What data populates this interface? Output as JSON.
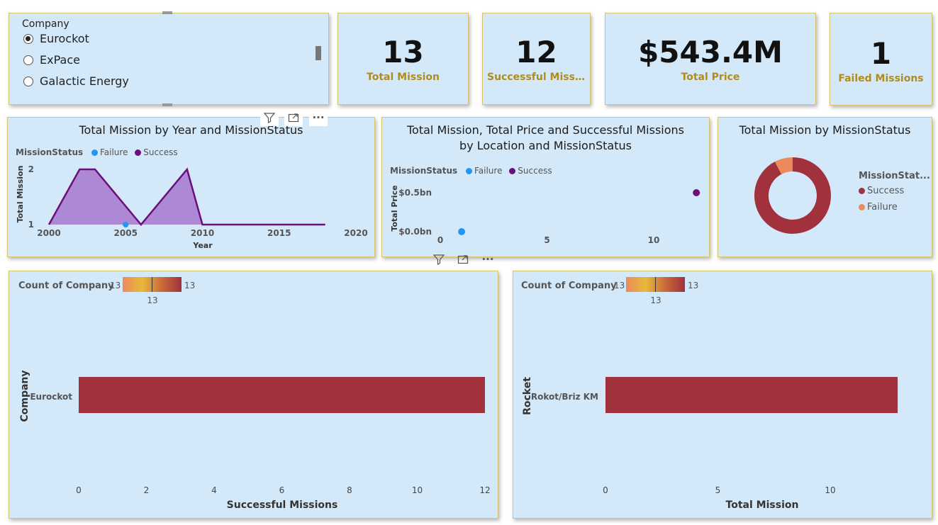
{
  "slicer": {
    "title": "Company",
    "options": [
      {
        "label": "Eurockot",
        "selected": true
      },
      {
        "label": "ExPace",
        "selected": false
      },
      {
        "label": "Galactic Energy",
        "selected": false
      }
    ]
  },
  "kpis": [
    {
      "value": "13",
      "label": "Total Mission"
    },
    {
      "value": "12",
      "label": "Successful Missions"
    },
    {
      "value": "$543.4M",
      "label": "Total Price"
    },
    {
      "value": "1",
      "label": "Failed Missions"
    }
  ],
  "visual_header_icons": [
    "filter-icon",
    "focus-mode-icon",
    "more-options-icon"
  ],
  "colors": {
    "failure": "#2196f3",
    "success": "#6b0f7a",
    "donut_success": "#a0313d",
    "donut_failure": "#ec8a5b",
    "bar": "#a0313d",
    "kpi_label": "#b08d1a",
    "tile_bg": "#d3e9fa",
    "tile_border": "#d6c56a"
  },
  "year_chart": {
    "title": "Total Mission by Year and MissionStatus",
    "legend_title": "MissionStatus",
    "legend": [
      "Failure",
      "Success"
    ],
    "ylabel": "Total Mission",
    "xlabel": "Year",
    "x_ticks": [
      "2000",
      "2005",
      "2010",
      "2015",
      "2020"
    ],
    "y_ticks": [
      "1",
      "2"
    ]
  },
  "location_chart": {
    "title": "Total Mission, Total Price and Successful Missions by Location and MissionStatus",
    "legend_title": "MissionStatus",
    "legend": [
      "Failure",
      "Success"
    ],
    "ylabel": "Total Price",
    "x_ticks": [
      "0",
      "5",
      "10"
    ],
    "y_ticks": [
      "$0.0bn",
      "$0.5bn"
    ]
  },
  "donut_chart": {
    "title": "Total Mission by MissionStatus",
    "legend_title": "MissionStat...",
    "legend": [
      "Success",
      "Failure"
    ]
  },
  "company_chart": {
    "gradient_title": "Count of Company",
    "gradient_min": "13",
    "gradient_max": "13",
    "gradient_mid": "13",
    "ylabel": "Company",
    "xlabel": "Successful Missions",
    "category": "Eurockot",
    "x_ticks": [
      "0",
      "2",
      "4",
      "6",
      "8",
      "10",
      "12"
    ]
  },
  "rocket_chart": {
    "gradient_title": "Count of Company",
    "gradient_min": "13",
    "gradient_max": "13",
    "gradient_mid": "13",
    "ylabel": "Rocket",
    "xlabel": "Total Mission",
    "category": "Rokot/Briz KM",
    "x_ticks": [
      "0",
      "5",
      "10"
    ]
  },
  "chart_data": [
    {
      "type": "area",
      "title": "Total Mission by Year and MissionStatus",
      "xlabel": "Year",
      "ylabel": "Total Mission",
      "xlim": [
        2000,
        2020
      ],
      "ylim": [
        1,
        2
      ],
      "series": [
        {
          "name": "Success",
          "x": [
            2000,
            2002,
            2003,
            2006,
            2009,
            2010,
            2018
          ],
          "values": [
            1,
            2,
            2,
            1,
            2,
            1,
            1
          ]
        },
        {
          "name": "Failure",
          "x": [
            2005
          ],
          "values": [
            1
          ]
        }
      ]
    },
    {
      "type": "scatter",
      "title": "Total Mission, Total Price and Successful Missions by Location and MissionStatus",
      "ylabel": "Total Price",
      "series": [
        {
          "name": "Failure",
          "x": [
            1
          ],
          "values": [
            0
          ]
        },
        {
          "name": "Success",
          "x": [
            12
          ],
          "values": [
            0.5
          ]
        }
      ]
    },
    {
      "type": "pie",
      "title": "Total Mission by MissionStatus",
      "categories": [
        "Success",
        "Failure"
      ],
      "values": [
        12,
        1
      ]
    },
    {
      "type": "bar",
      "xlabel": "Successful Missions",
      "ylabel": "Company",
      "categories": [
        "Eurockot"
      ],
      "values": [
        12
      ],
      "xlim": [
        0,
        12
      ]
    },
    {
      "type": "bar",
      "xlabel": "Total Mission",
      "ylabel": "Rocket",
      "categories": [
        "Rokot/Briz KM"
      ],
      "values": [
        13
      ],
      "xlim": [
        0,
        13
      ]
    }
  ]
}
